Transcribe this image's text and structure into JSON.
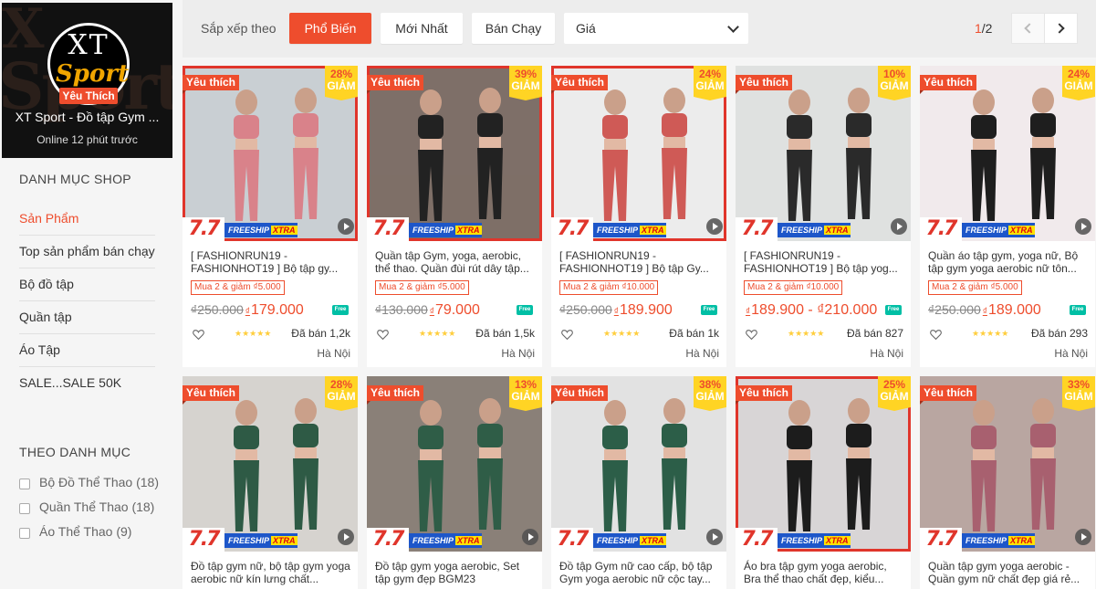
{
  "shop": {
    "logo_top": "XT",
    "logo_bottom": "Sport",
    "bg_text": "Sport",
    "bg_x": "X",
    "fav_badge": "Yêu Thích",
    "name": "XT Sport - Đồ tập Gym ...",
    "online": "Online 12 phút trước"
  },
  "sidebar": {
    "title": "DANH MỤC SHOP",
    "items": [
      {
        "label": "Sản Phẩm"
      },
      {
        "label": "Top sản phẩm bán chạy"
      },
      {
        "label": "Bộ đồ tập"
      },
      {
        "label": "Quần tập"
      },
      {
        "label": "Áo Tập"
      },
      {
        "label": "SALE...SALE 50K"
      }
    ],
    "filter_title": "THEO DANH MỤC",
    "filters": [
      {
        "label": "Bộ Đồ Thể Thao (18)"
      },
      {
        "label": "Quần Thể Thao (18)"
      },
      {
        "label": "Áo Thể Thao (9)"
      }
    ]
  },
  "sortbar": {
    "label": "Sắp xếp theo",
    "popular": "Phổ Biến",
    "newest": "Mới Nhất",
    "bestseller": "Bán Chạy",
    "price": "Giá",
    "page_current": "1",
    "page_total": "/2"
  },
  "badges": {
    "favorite": "Yêu thích",
    "discount_suffix": "GIẢM",
    "promo_77": "7.7",
    "freeship": "FREESHIP",
    "xtra": "XTRA",
    "free_icon": "Free"
  },
  "colors": {
    "accent": "#ee4d2d",
    "discount_bg": "#ffd424",
    "star": "#ffce3d"
  },
  "products": [
    {
      "title": "[ FASHIONRUN19 - FASHIONHOT19 ] Bộ tập gy...",
      "discount": "28%",
      "promo": "Mua 2 & giảm ₫5.000",
      "old_price": "₫250.000",
      "price": "179.000",
      "sold": "Đã bán 1,2k",
      "location": "Hà Nội",
      "bg": "#c9cfd3",
      "fg": "#d9828a",
      "red_frame": true,
      "video": true
    },
    {
      "title": "Quần tập Gym, yoga, aerobic, thể thao. Quần đùi rút dây tập...",
      "discount": "39%",
      "promo": "Mua 2 & giảm ₫5.000",
      "old_price": "₫130.000",
      "price": "79.000",
      "sold": "Đã bán 1,5k",
      "location": "Hà Nội",
      "bg": "#7e6f68",
      "fg": "#222222",
      "red_frame": true,
      "video": false
    },
    {
      "title": "[ FASHIONRUN19 - FASHIONHOT19 ] Bộ tập Gy...",
      "discount": "24%",
      "promo": "Mua 2 & giảm ₫10.000",
      "old_price": "₫250.000",
      "price": "189.900",
      "sold": "Đã bán 1k",
      "location": "Hà Nội",
      "bg": "#ececec",
      "fg": "#cf5a56",
      "red_frame": true,
      "video": true
    },
    {
      "title": "[ FASHIONRUN19 - FASHIONHOT19 ] Bộ tập yog...",
      "discount": "10%",
      "promo": "Mua 2 & giảm ₫10.000",
      "old_price": "",
      "price": "189.900 - ₫210.000",
      "sold": "Đã bán 827",
      "location": "Hà Nội",
      "bg": "#dfe1e0",
      "fg": "#2a2a2a",
      "red_frame": false,
      "video": true
    },
    {
      "title": "Quần áo tập gym, yoga nữ, Bộ tập gym yoga aerobic nữ tôn...",
      "discount": "24%",
      "promo": "Mua 2 & giảm ₫5.000",
      "old_price": "₫250.000",
      "price": "189.000",
      "sold": "Đã bán 293",
      "location": "Hà Nội",
      "bg": "#f1eaec",
      "fg": "#1e1e1e",
      "red_frame": false,
      "video": true
    },
    {
      "title": "Đồ tập gym nữ, bộ tập gym yoga aerobic nữ kín lưng chất...",
      "discount": "28%",
      "promo": "",
      "old_price": "",
      "price": "",
      "sold": "",
      "location": "",
      "bg": "#d6d3cf",
      "fg": "#2e5a45",
      "red_frame": false,
      "video": true
    },
    {
      "title": "Đồ tập gym yoga aerobic, Set tập gym đẹp BGM23",
      "discount": "13%",
      "promo": "",
      "old_price": "",
      "price": "",
      "sold": "",
      "location": "",
      "bg": "#8a8078",
      "fg": "#2f5d47",
      "red_frame": false,
      "video": true
    },
    {
      "title": "Đồ tập Gym nữ cao cấp, bộ tập Gym yoga aerobic nữ cộc tay...",
      "discount": "38%",
      "promo": "",
      "old_price": "",
      "price": "",
      "sold": "",
      "location": "",
      "bg": "#e2e2e2",
      "fg": "#2c5e48",
      "red_frame": false,
      "video": true
    },
    {
      "title": "Áo bra tập gym yoga aerobic, Bra thể thao chất đẹp, kiểu...",
      "discount": "25%",
      "promo": "",
      "old_price": "",
      "price": "",
      "sold": "",
      "location": "",
      "bg": "#d8d5d6",
      "fg": "#1c1c1c",
      "red_frame": true,
      "video": false
    },
    {
      "title": "Quần tập gym yoga aerobic - Quần gym nữ chất đẹp giá rẻ...",
      "discount": "33%",
      "promo": "",
      "old_price": "",
      "price": "",
      "sold": "",
      "location": "",
      "bg": "#b9a6a1",
      "fg": "#a8606f",
      "red_frame": false,
      "video": true
    }
  ]
}
